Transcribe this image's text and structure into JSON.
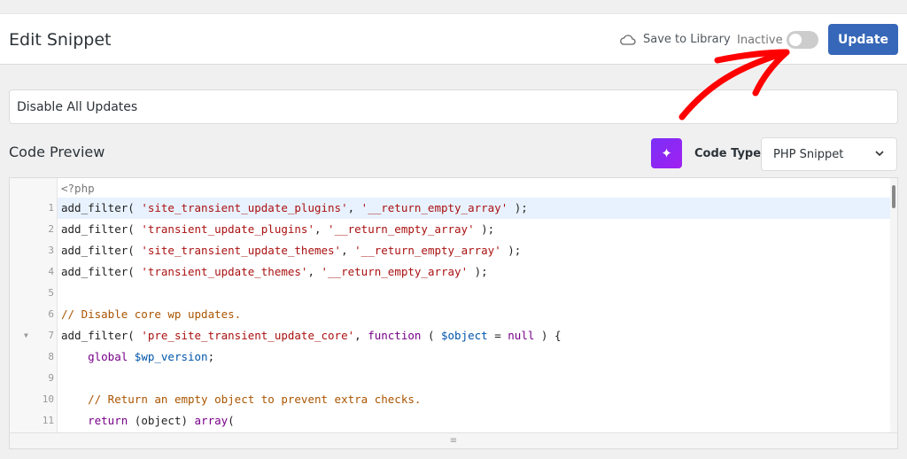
{
  "header": {
    "title": "Edit Snippet",
    "save_library": "Save to Library",
    "status": "Inactive",
    "active": false,
    "update_label": "Update"
  },
  "snippet": {
    "name": "Disable All Updates"
  },
  "code_preview": {
    "label": "Code Preview",
    "code_type_label": "Code Type",
    "code_type_value": "PHP Snippet"
  },
  "editor": {
    "open_tag": "<?php",
    "lines": [
      {
        "n": "1",
        "hl": true,
        "t": [
          [
            "",
            "add_filter( "
          ],
          [
            "str",
            "'site_transient_update_plugins'"
          ],
          [
            "",
            ", "
          ],
          [
            "str",
            "'__return_empty_array'"
          ],
          [
            "",
            " );"
          ]
        ]
      },
      {
        "n": "2",
        "t": [
          [
            "",
            "add_filter( "
          ],
          [
            "str",
            "'transient_update_plugins'"
          ],
          [
            "",
            ", "
          ],
          [
            "str",
            "'__return_empty_array'"
          ],
          [
            "",
            " );"
          ]
        ]
      },
      {
        "n": "3",
        "t": [
          [
            "",
            "add_filter( "
          ],
          [
            "str",
            "'site_transient_update_themes'"
          ],
          [
            "",
            ", "
          ],
          [
            "str",
            "'__return_empty_array'"
          ],
          [
            "",
            " );"
          ]
        ]
      },
      {
        "n": "4",
        "t": [
          [
            "",
            "add_filter( "
          ],
          [
            "str",
            "'transient_update_themes'"
          ],
          [
            "",
            ", "
          ],
          [
            "str",
            "'__return_empty_array'"
          ],
          [
            "",
            " );"
          ]
        ]
      },
      {
        "n": "5",
        "t": []
      },
      {
        "n": "6",
        "t": [
          [
            "com",
            "// Disable core wp updates."
          ]
        ]
      },
      {
        "n": "7",
        "fold": true,
        "t": [
          [
            "",
            "add_filter( "
          ],
          [
            "str",
            "'pre_site_transient_update_core'"
          ],
          [
            "",
            ", "
          ],
          [
            "kw",
            "function"
          ],
          [
            "",
            " ( "
          ],
          [
            "var",
            "$object"
          ],
          [
            "",
            " = "
          ],
          [
            "kw",
            "null"
          ],
          [
            "",
            " ) {"
          ]
        ]
      },
      {
        "n": "8",
        "t": [
          [
            "",
            "    "
          ],
          [
            "kw",
            "global"
          ],
          [
            "",
            " "
          ],
          [
            "var",
            "$wp_version"
          ],
          [
            "",
            ";"
          ]
        ]
      },
      {
        "n": "9",
        "t": []
      },
      {
        "n": "10",
        "t": [
          [
            "",
            "    "
          ],
          [
            "com",
            "// Return an empty object to prevent extra checks."
          ]
        ]
      },
      {
        "n": "11",
        "t": [
          [
            "",
            "    "
          ],
          [
            "kw",
            "return"
          ],
          [
            "",
            " (object) "
          ],
          [
            "kw",
            "array"
          ],
          [
            "",
            "("
          ]
        ]
      }
    ]
  },
  "colors": {
    "accent": "#3667b8",
    "ai": "#8a2be2",
    "arrow": "#ff0000"
  }
}
